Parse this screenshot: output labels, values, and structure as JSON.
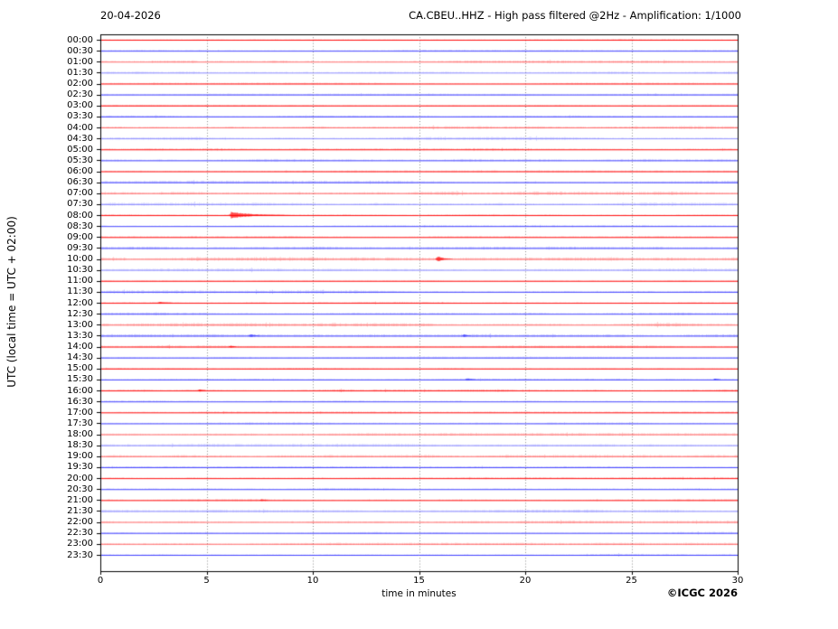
{
  "header": {
    "date": "20-04-2026",
    "title": "CA.CBEU..HHZ - High pass filtered @2Hz - Amplification: 1/1000"
  },
  "footer": {
    "copyright": "©ICGC 2026"
  },
  "chart_data": {
    "type": "line",
    "subtype": "helicorder-dayplot",
    "xlabel": "time in minutes",
    "ylabel": "UTC (local time = UTC + 02:00)",
    "xlim": [
      0,
      30
    ],
    "x_ticks": [
      0,
      5,
      10,
      15,
      20,
      25,
      30
    ],
    "grid": "vertical-dotted-5min",
    "legend": "none",
    "colors": {
      "red": "#ff0000",
      "blue": "#3c3cff",
      "grid": "#8a8a8a",
      "axis": "#000000"
    },
    "rows": [
      {
        "label": "00:00",
        "color": "red",
        "amp": 0.7,
        "intensity": "normal",
        "events": []
      },
      {
        "label": "00:30",
        "color": "blue",
        "amp": 0.8,
        "intensity": "normal",
        "events": []
      },
      {
        "label": "01:00",
        "color": "red",
        "amp": 1.1,
        "intensity": "light",
        "events": []
      },
      {
        "label": "01:30",
        "color": "blue",
        "amp": 1.2,
        "intensity": "light",
        "events": []
      },
      {
        "label": "02:00",
        "color": "red",
        "amp": 0.7,
        "intensity": "normal",
        "events": []
      },
      {
        "label": "02:30",
        "color": "blue",
        "amp": 0.8,
        "intensity": "normal",
        "events": []
      },
      {
        "label": "03:00",
        "color": "red",
        "amp": 0.7,
        "intensity": "normal",
        "events": []
      },
      {
        "label": "03:30",
        "color": "blue",
        "amp": 0.9,
        "intensity": "normal",
        "events": []
      },
      {
        "label": "04:00",
        "color": "red",
        "amp": 1.2,
        "intensity": "light",
        "events": []
      },
      {
        "label": "04:30",
        "color": "blue",
        "amp": 1.3,
        "intensity": "light",
        "events": []
      },
      {
        "label": "05:00",
        "color": "red",
        "amp": 0.8,
        "intensity": "normal",
        "events": []
      },
      {
        "label": "05:30",
        "color": "blue",
        "amp": 1.0,
        "intensity": "normal",
        "events": []
      },
      {
        "label": "06:00",
        "color": "red",
        "amp": 0.7,
        "intensity": "normal",
        "events": []
      },
      {
        "label": "06:30",
        "color": "blue",
        "amp": 1.2,
        "intensity": "normal",
        "events": []
      },
      {
        "label": "07:00",
        "color": "red",
        "amp": 1.8,
        "intensity": "light",
        "events": []
      },
      {
        "label": "07:30",
        "color": "blue",
        "amp": 1.4,
        "intensity": "light",
        "events": []
      },
      {
        "label": "08:00",
        "color": "red",
        "amp": 0.8,
        "intensity": "normal",
        "events": [
          {
            "minute": 6.15,
            "amp": 4.0,
            "dur": 2.0
          }
        ]
      },
      {
        "label": "08:30",
        "color": "blue",
        "amp": 0.8,
        "intensity": "normal",
        "events": []
      },
      {
        "label": "09:00",
        "color": "red",
        "amp": 0.7,
        "intensity": "normal",
        "events": []
      },
      {
        "label": "09:30",
        "color": "blue",
        "amp": 1.2,
        "intensity": "normal",
        "events": []
      },
      {
        "label": "10:00",
        "color": "red",
        "amp": 1.7,
        "intensity": "light",
        "events": [
          {
            "minute": 15.85,
            "amp": 3.2,
            "dur": 0.6
          }
        ]
      },
      {
        "label": "10:30",
        "color": "blue",
        "amp": 1.3,
        "intensity": "light",
        "events": []
      },
      {
        "label": "11:00",
        "color": "red",
        "amp": 0.7,
        "intensity": "normal",
        "events": []
      },
      {
        "label": "11:30",
        "color": "blue",
        "amp": 1.3,
        "intensity": "normal",
        "events": []
      },
      {
        "label": "12:00",
        "color": "red",
        "amp": 0.8,
        "intensity": "normal",
        "events": [
          {
            "minute": 2.75,
            "amp": 1.2,
            "dur": 0.8
          }
        ]
      },
      {
        "label": "12:30",
        "color": "blue",
        "amp": 1.2,
        "intensity": "normal",
        "events": []
      },
      {
        "label": "13:00",
        "color": "red",
        "amp": 1.6,
        "intensity": "light",
        "events": []
      },
      {
        "label": "13:30",
        "color": "blue",
        "amp": 1.4,
        "intensity": "normal",
        "events": [
          {
            "minute": 7.05,
            "amp": 2.2,
            "dur": 0.4
          },
          {
            "minute": 17.1,
            "amp": 1.8,
            "dur": 0.35
          }
        ]
      },
      {
        "label": "14:00",
        "color": "red",
        "amp": 1.2,
        "intensity": "normal",
        "events": [
          {
            "minute": 6.1,
            "amp": 1.3,
            "dur": 0.3
          }
        ]
      },
      {
        "label": "14:30",
        "color": "blue",
        "amp": 0.9,
        "intensity": "normal",
        "events": []
      },
      {
        "label": "15:00",
        "color": "red",
        "amp": 0.7,
        "intensity": "normal",
        "events": []
      },
      {
        "label": "15:30",
        "color": "blue",
        "amp": 1.0,
        "intensity": "normal",
        "events": [
          {
            "minute": 17.25,
            "amp": 1.8,
            "dur": 0.45
          },
          {
            "minute": 28.9,
            "amp": 1.4,
            "dur": 0.25
          }
        ]
      },
      {
        "label": "16:00",
        "color": "red",
        "amp": 1.0,
        "intensity": "normal",
        "events": [
          {
            "minute": 4.65,
            "amp": 1.8,
            "dur": 0.3
          }
        ]
      },
      {
        "label": "16:30",
        "color": "blue",
        "amp": 0.8,
        "intensity": "normal",
        "events": []
      },
      {
        "label": "17:00",
        "color": "red",
        "amp": 0.7,
        "intensity": "normal",
        "events": []
      },
      {
        "label": "17:30",
        "color": "blue",
        "amp": 0.8,
        "intensity": "normal",
        "events": []
      },
      {
        "label": "18:00",
        "color": "red",
        "amp": 1.1,
        "intensity": "light",
        "events": []
      },
      {
        "label": "18:30",
        "color": "blue",
        "amp": 1.3,
        "intensity": "light",
        "events": []
      },
      {
        "label": "19:00",
        "color": "red",
        "amp": 1.3,
        "intensity": "light",
        "events": []
      },
      {
        "label": "19:30",
        "color": "blue",
        "amp": 0.9,
        "intensity": "normal",
        "events": []
      },
      {
        "label": "20:00",
        "color": "red",
        "amp": 0.8,
        "intensity": "normal",
        "events": []
      },
      {
        "label": "20:30",
        "color": "blue",
        "amp": 0.9,
        "intensity": "normal",
        "events": []
      },
      {
        "label": "21:00",
        "color": "red",
        "amp": 0.8,
        "intensity": "normal",
        "events": [
          {
            "minute": 7.55,
            "amp": 1.2,
            "dur": 0.4
          }
        ]
      },
      {
        "label": "21:30",
        "color": "blue",
        "amp": 1.4,
        "intensity": "light",
        "events": []
      },
      {
        "label": "22:00",
        "color": "red",
        "amp": 1.2,
        "intensity": "light",
        "events": []
      },
      {
        "label": "22:30",
        "color": "blue",
        "amp": 0.9,
        "intensity": "normal",
        "events": []
      },
      {
        "label": "23:00",
        "color": "red",
        "amp": 1.1,
        "intensity": "light",
        "events": []
      },
      {
        "label": "23:30",
        "color": "blue",
        "amp": 0.9,
        "intensity": "normal",
        "events": []
      }
    ]
  }
}
